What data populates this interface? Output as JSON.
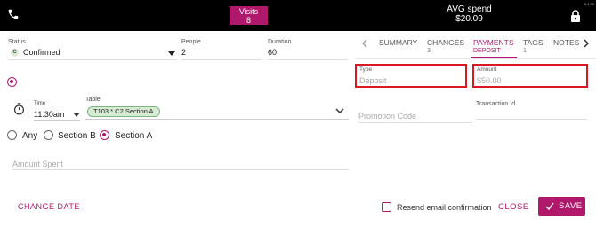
{
  "header": {
    "visits_label": "Visits",
    "visits_count": "8",
    "avg_spend_label": "AVG spend",
    "avg_spend_value": "$20.09",
    "version": "5.4.39",
    "icons": {
      "phone": "phone-icon",
      "lock": "lock-icon"
    }
  },
  "reservation": {
    "status_label": "Status",
    "status_badge": "C",
    "status_value": "Confirmed",
    "people_label": "People",
    "people_value": "2",
    "duration_label": "Duration",
    "duration_value": "60",
    "time_label": "Time",
    "time_value": "11:30am",
    "table_label": "Table",
    "table_chip": "T103 * C2 Section A",
    "sections": [
      {
        "label": "Any",
        "selected": false
      },
      {
        "label": "Section B",
        "selected": false
      },
      {
        "label": "Section A",
        "selected": true
      }
    ],
    "amount_spent_placeholder": "Amount Spent",
    "change_date_label": "CHANGE DATE"
  },
  "tabs": [
    {
      "label": "SUMMARY",
      "sub": "",
      "active": false
    },
    {
      "label": "CHANGES",
      "sub": "3",
      "active": false
    },
    {
      "label": "PAYMENTS",
      "sub": "DEPOSIT",
      "active": true
    },
    {
      "label": "TAGS",
      "sub": "1",
      "active": false
    },
    {
      "label": "NOTES",
      "sub": "",
      "active": false
    }
  ],
  "payment": {
    "type_label": "Type",
    "type_placeholder": "Deposit",
    "amount_label": "Amount",
    "amount_placeholder": "$50.00",
    "promo_placeholder": "Promotion Code",
    "transaction_label": "Transaction Id"
  },
  "footer": {
    "resend_label": "Resend email confirmation",
    "resend_checked": false,
    "close_label": "CLOSE",
    "save_label": "SAVE"
  },
  "colors": {
    "accent": "#b0196b",
    "error": "#d9191f",
    "topbar": "#000000",
    "chip_bg": "#d7ecd4"
  }
}
